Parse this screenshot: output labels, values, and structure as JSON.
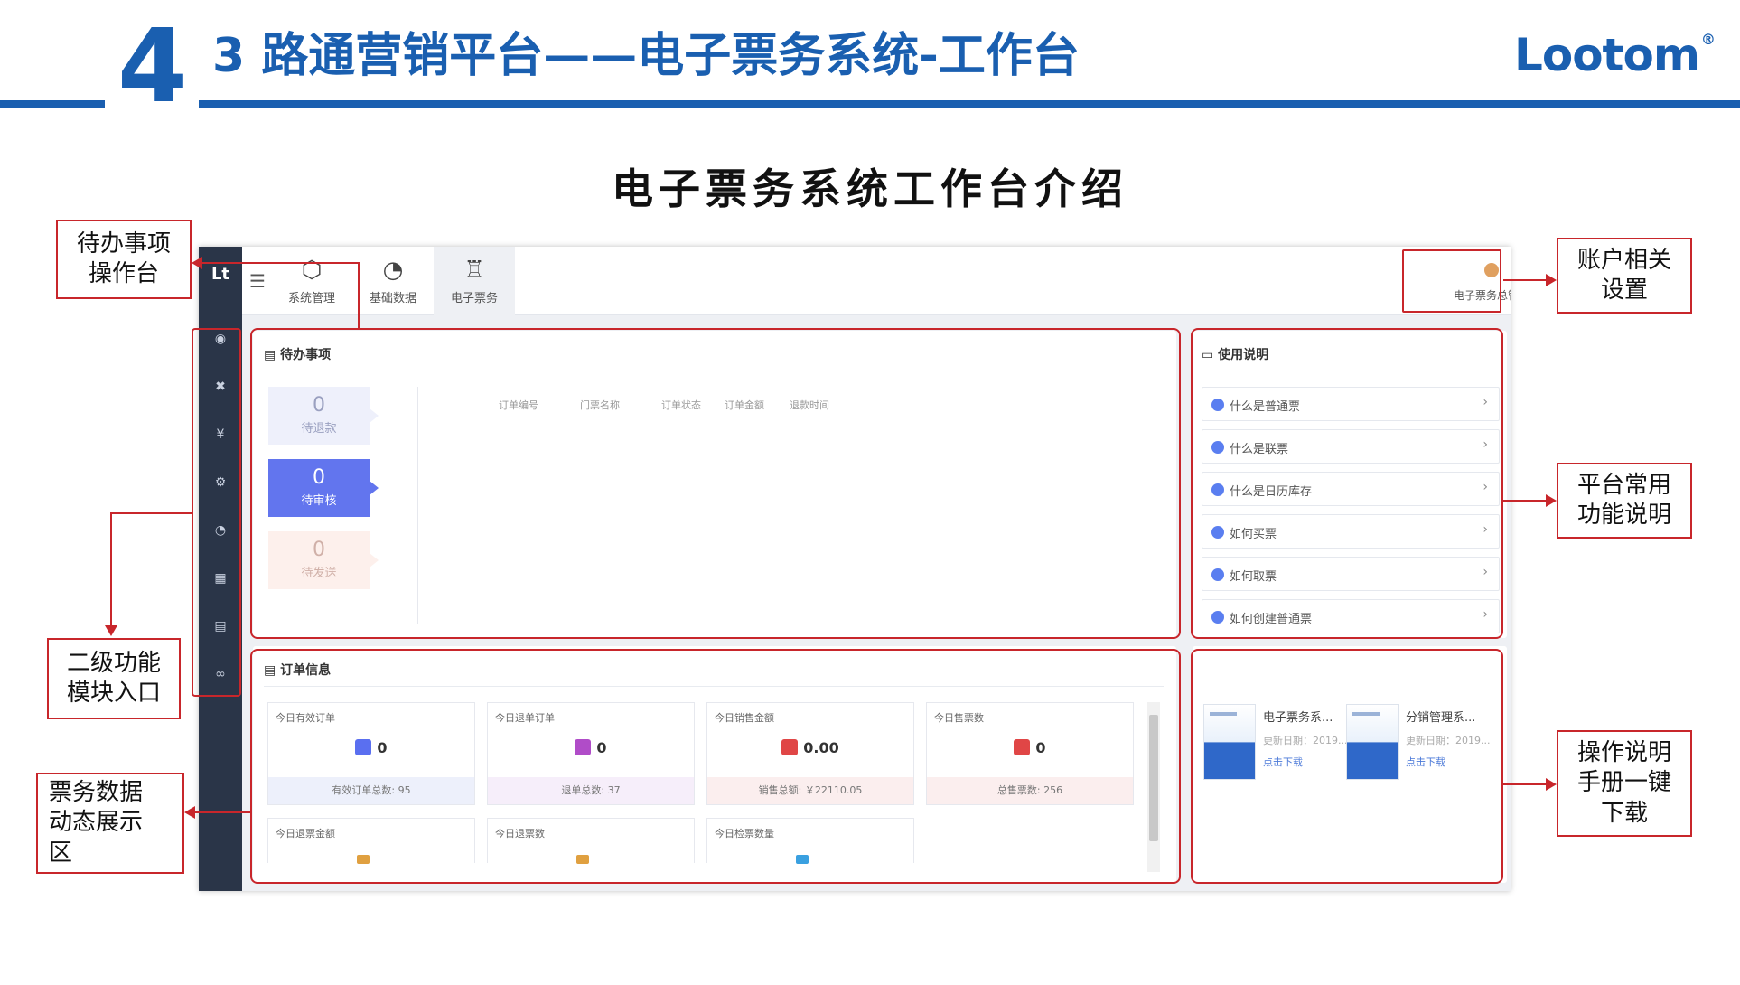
{
  "slide": {
    "chapter_number": "4",
    "title": "3 路通营销平台——电子票务系统-工作台",
    "brand": "Lootom",
    "subtitle": "电子票务系统工作台介绍"
  },
  "app": {
    "logo": "Lt",
    "topnav": [
      {
        "label": "系统管理",
        "icon": "hexagon-icon"
      },
      {
        "label": "基础数据",
        "icon": "pie-icon"
      },
      {
        "label": "电子票务",
        "icon": "ticket-icon"
      }
    ],
    "account_label": "电子票务总管理",
    "sidebar_icons": [
      "dashboard-icon",
      "ticket-icon",
      "yen-icon",
      "gear-icon",
      "pie-chart-icon",
      "grid-icon",
      "document-icon",
      "binoculars-icon"
    ],
    "todo": {
      "title": "待办事项",
      "cards": [
        {
          "count": "0",
          "label": "待退款"
        },
        {
          "count": "0",
          "label": "待审核"
        },
        {
          "count": "0",
          "label": "待发送"
        }
      ],
      "columns": [
        "订单编号",
        "门票名称",
        "订单状态",
        "订单金额",
        "退款时间"
      ]
    },
    "help": {
      "title": "使用说明",
      "items": [
        "什么是普通票",
        "什么是联票",
        "什么是日历库存",
        "如何买票",
        "如何取票",
        "如何创建普通票"
      ]
    },
    "orders": {
      "title": "订单信息",
      "stats": [
        {
          "title": "今日有效订单",
          "value": "0",
          "footer": "有效订单总数: 95",
          "color": "#5a6ff0",
          "foot_bg": "#edf0fb"
        },
        {
          "title": "今日退单订单",
          "value": "0",
          "footer": "退单总数: 37",
          "color": "#b04cc8",
          "foot_bg": "#f6eefa"
        },
        {
          "title": "今日销售金额",
          "value": "0.00",
          "footer": "销售总额: ￥22110.05",
          "color": "#e04646",
          "foot_bg": "#fbeeee"
        },
        {
          "title": "今日售票数",
          "value": "0",
          "footer": "总售票数: 256",
          "color": "#e04646",
          "foot_bg": "#fbeeee"
        },
        {
          "title": "今日退票金额",
          "value": "",
          "footer": "",
          "color": "#e0a040",
          "foot_bg": "#ffffff"
        },
        {
          "title": "今日退票数",
          "value": "",
          "footer": "",
          "color": "#e0a040",
          "foot_bg": "#ffffff"
        },
        {
          "title": "今日检票数量",
          "value": "",
          "footer": "",
          "color": "#3aa0e0",
          "foot_bg": "#ffffff"
        }
      ]
    },
    "downloads": [
      {
        "title": "电子票务系...",
        "date": "更新日期：2019...",
        "link": "点击下载",
        "thumb_caption": "电子票务系统"
      },
      {
        "title": "分销管理系...",
        "date": "更新日期：2019...",
        "link": "点击下载",
        "thumb_caption": "电子票务系统"
      }
    ]
  },
  "annotations": {
    "todo": [
      "待办事项",
      "操作台"
    ],
    "submodule": [
      "二级功能",
      "模块入口"
    ],
    "data": [
      "票务数据",
      "动态展示",
      "区"
    ],
    "account": [
      "账户相关",
      "设置"
    ],
    "functions": [
      "平台常用",
      "功能说明"
    ],
    "manual": [
      "操作说明",
      "手册一键",
      "下载"
    ],
    "color": "#c8262b"
  }
}
